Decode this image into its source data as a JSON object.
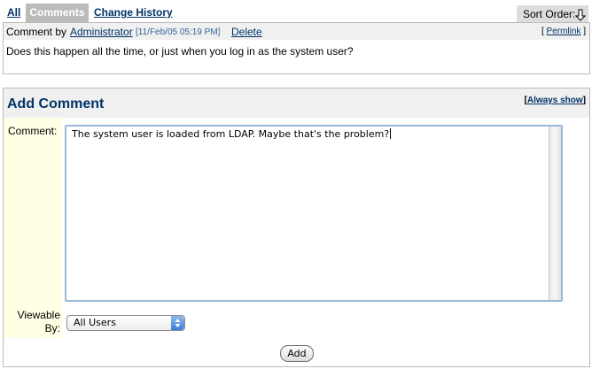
{
  "tabs": {
    "all": "All",
    "comments": "Comments",
    "change_history": "Change History"
  },
  "sort": {
    "label": "Sort Order:",
    "icon": "sort-down-arrow-icon"
  },
  "comment": {
    "by_label": "Comment by",
    "author": "Administrator",
    "date": "[11/Feb/05 05:19 PM]",
    "delete": "Delete",
    "permalink_open": "[",
    "permalink": "Permlink",
    "permalink_close": "]",
    "body": "Does this happen all the time, or just when you log in as the system user?"
  },
  "add_comment": {
    "title": "Add Comment",
    "always_show_open": "[",
    "always_show": "Always show",
    "always_show_close": "]",
    "comment_label": "Comment:",
    "comment_value": "The system user is loaded from LDAP. Maybe that's the problem?",
    "viewable_label": "Viewable By:",
    "viewable_value": "All Users",
    "add_button": "Add"
  },
  "colors": {
    "link": "#003366",
    "active_tab_bg": "#bbbbbb",
    "header_bg": "#f0f0f0",
    "label_bg": "#ffffe6"
  }
}
